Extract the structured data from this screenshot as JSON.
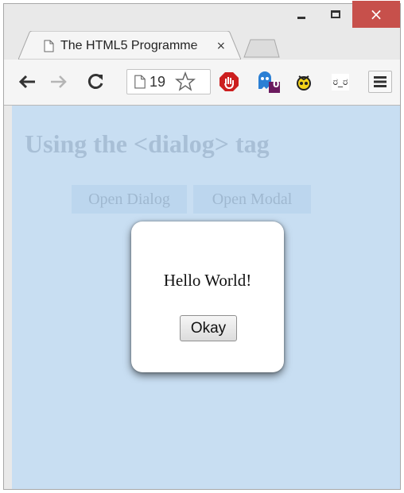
{
  "browser": {
    "tab_title": "The HTML5 Programme",
    "tab_close": "×",
    "address_text": "19",
    "extension_badge": "0",
    "extension_face_text": "ರ_ರ",
    "window_buttons": {
      "close": "×"
    }
  },
  "page": {
    "heading": "Using the <dialog> tag",
    "open_dialog_label": "Open Dialog",
    "open_modal_label": "Open Modal",
    "background_color": "#cfe1f3"
  },
  "dialog": {
    "message": "Hello World!",
    "okay_label": "Okay"
  }
}
